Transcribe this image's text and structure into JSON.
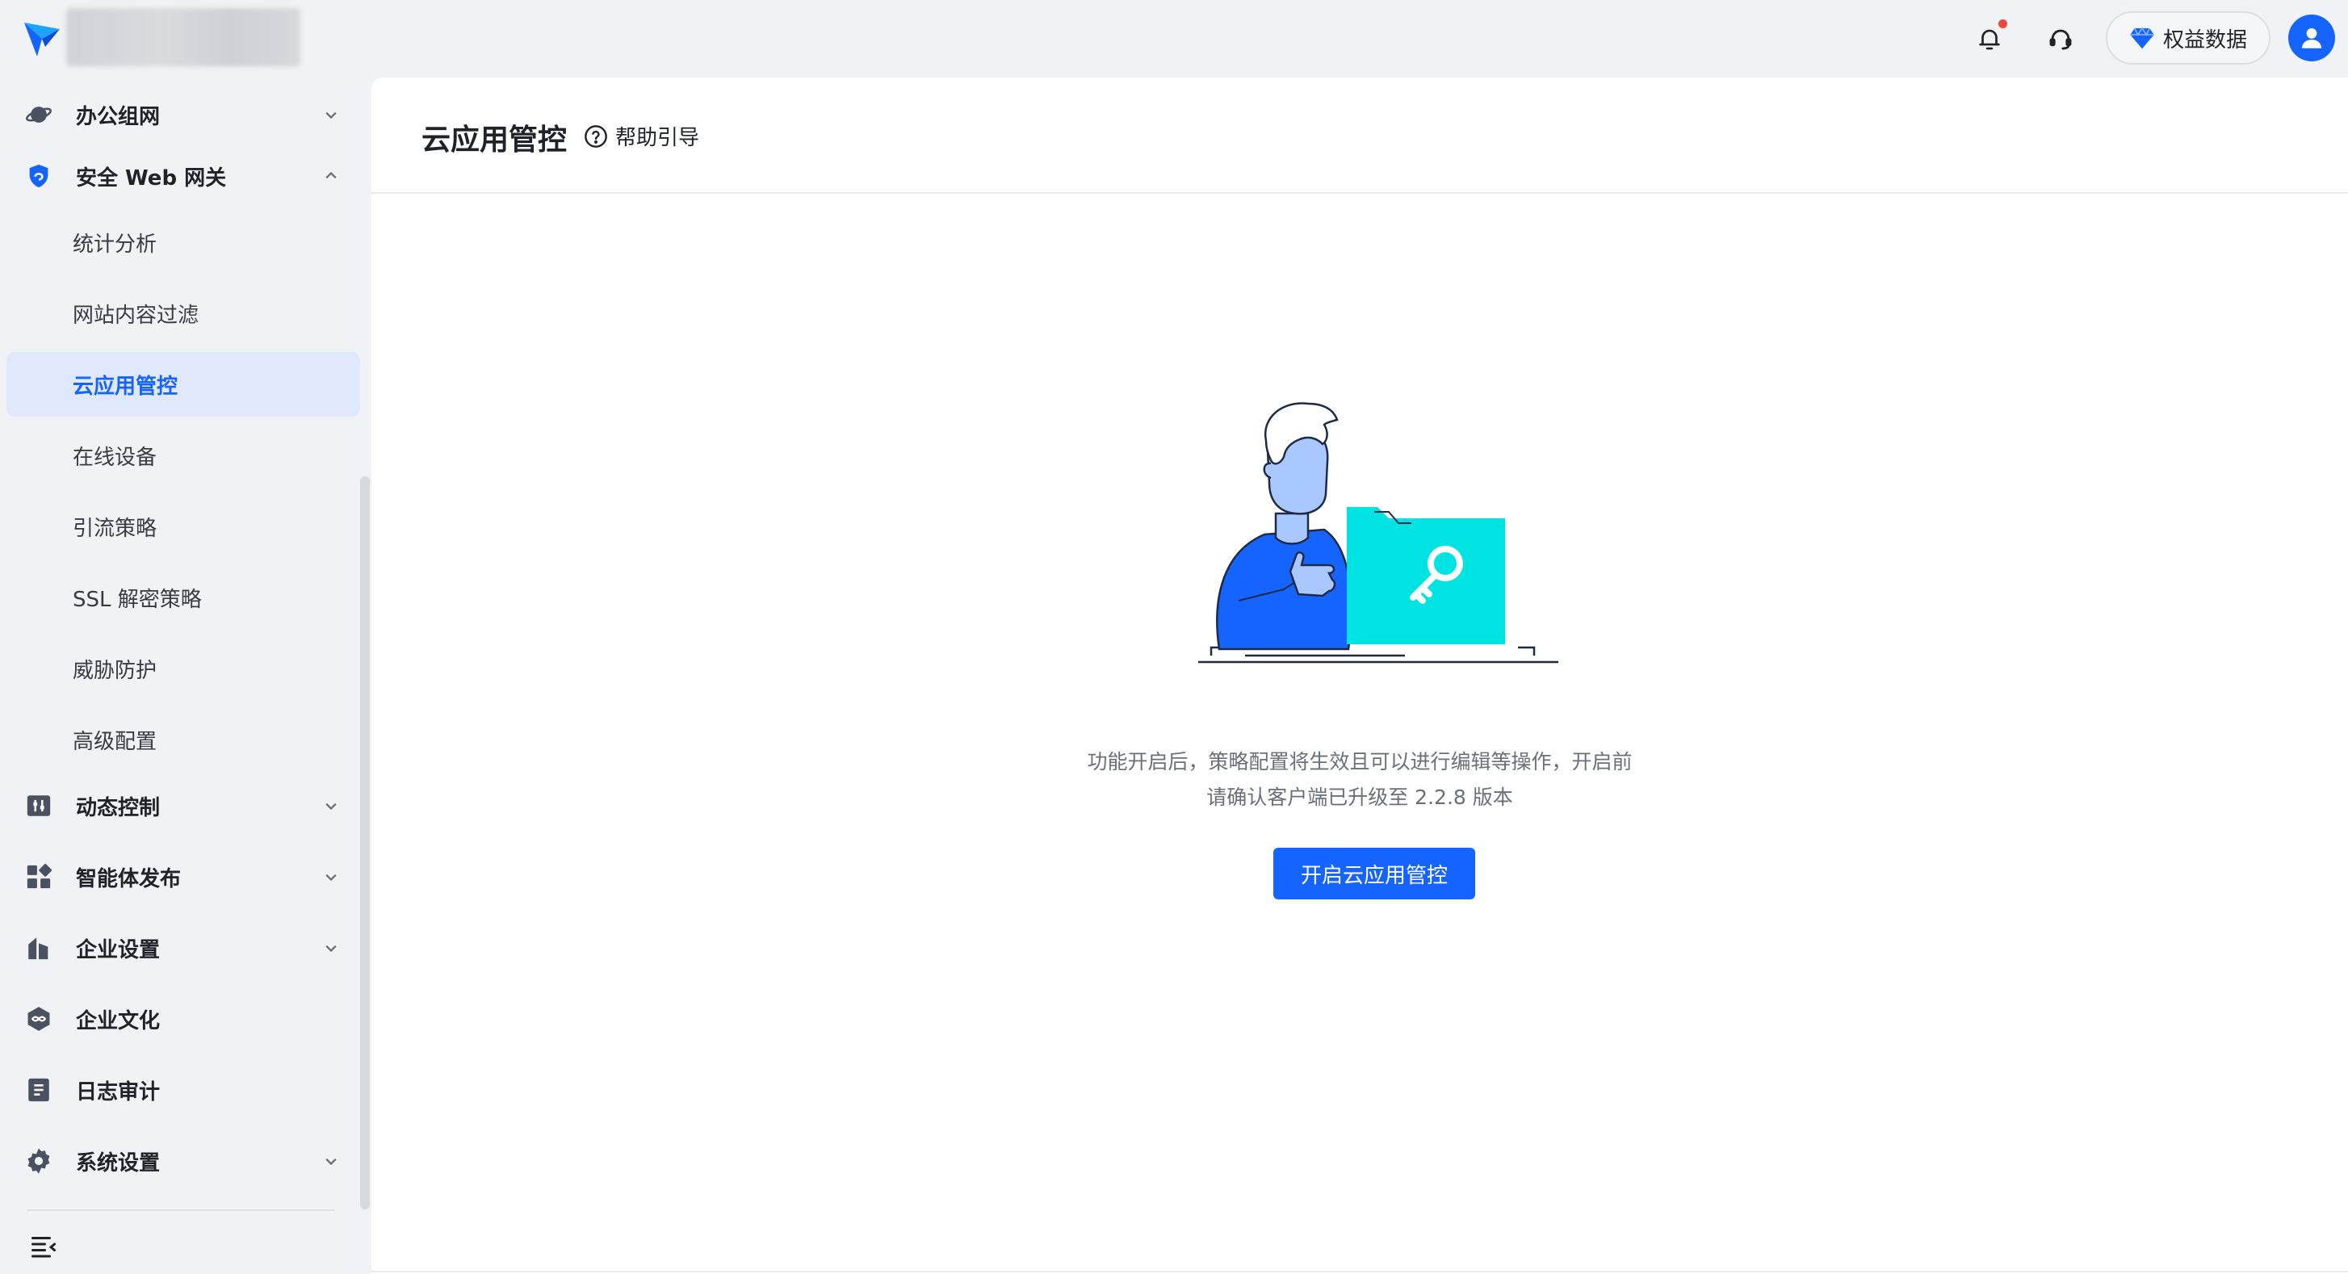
{
  "topbar": {
    "benefit_label": "权益数据"
  },
  "sidebar": {
    "items": [
      {
        "label": "办公组网"
      },
      {
        "label": "安全 Web 网关"
      },
      {
        "label": "统计分析"
      },
      {
        "label": "网站内容过滤"
      },
      {
        "label": "云应用管控"
      },
      {
        "label": "在线设备"
      },
      {
        "label": "引流策略"
      },
      {
        "label": "SSL 解密策略"
      },
      {
        "label": "威胁防护"
      },
      {
        "label": "高级配置"
      },
      {
        "label": "动态控制"
      },
      {
        "label": "智能体发布"
      },
      {
        "label": "企业设置"
      },
      {
        "label": "企业文化"
      },
      {
        "label": "日志审计"
      },
      {
        "label": "系统设置"
      }
    ]
  },
  "main": {
    "title": "云应用管控",
    "help_label": "帮助引导",
    "description_line1": "功能开启后，策略配置将生效且可以进行编辑等操作，开启前",
    "description_line2": "请确认客户端已升级至 2.2.8 版本",
    "cta_label": "开启云应用管控"
  },
  "colors": {
    "accent": "#1664ff",
    "active_bg": "#e0e9fb",
    "notification": "#f0433a",
    "folder": "#00e3e3"
  }
}
